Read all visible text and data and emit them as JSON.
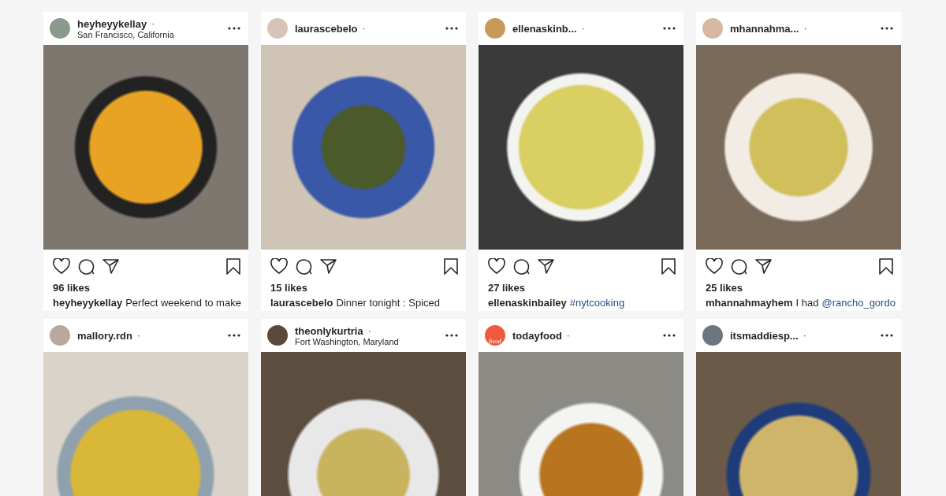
{
  "posts": [
    {
      "username": "heyheyykellay",
      "separator": "·",
      "location": "San Francisco, California",
      "likes": "96 likes",
      "caption": {
        "user": "heyheyykellay",
        "text": "Perfect weekend to make"
      }
    },
    {
      "username": "laurascebelo",
      "separator": "·",
      "likes": "15 likes",
      "caption": {
        "user": "laurascebelo",
        "text": "Dinner tonight : Spiced"
      }
    },
    {
      "username": "ellenaskinb...",
      "separator": "·",
      "likes": "27 likes",
      "caption": {
        "user": "ellenaskinbailey",
        "link": "#nytcooking"
      }
    },
    {
      "username": "mhannahma...",
      "separator": "·",
      "likes": "25 likes",
      "caption": {
        "user": "mhannahmayhem",
        "text": "I had",
        "link": "@rancho_gordo"
      }
    },
    {
      "username": "mallory.rdn",
      "separator": "·"
    },
    {
      "username": "theonlykurtria",
      "separator": "·",
      "location": "Fort Washington, Maryland"
    },
    {
      "username": "todayfood",
      "separator": "·",
      "logo_text": "food"
    },
    {
      "username": "itsmaddiesp...",
      "separator": "·"
    }
  ]
}
